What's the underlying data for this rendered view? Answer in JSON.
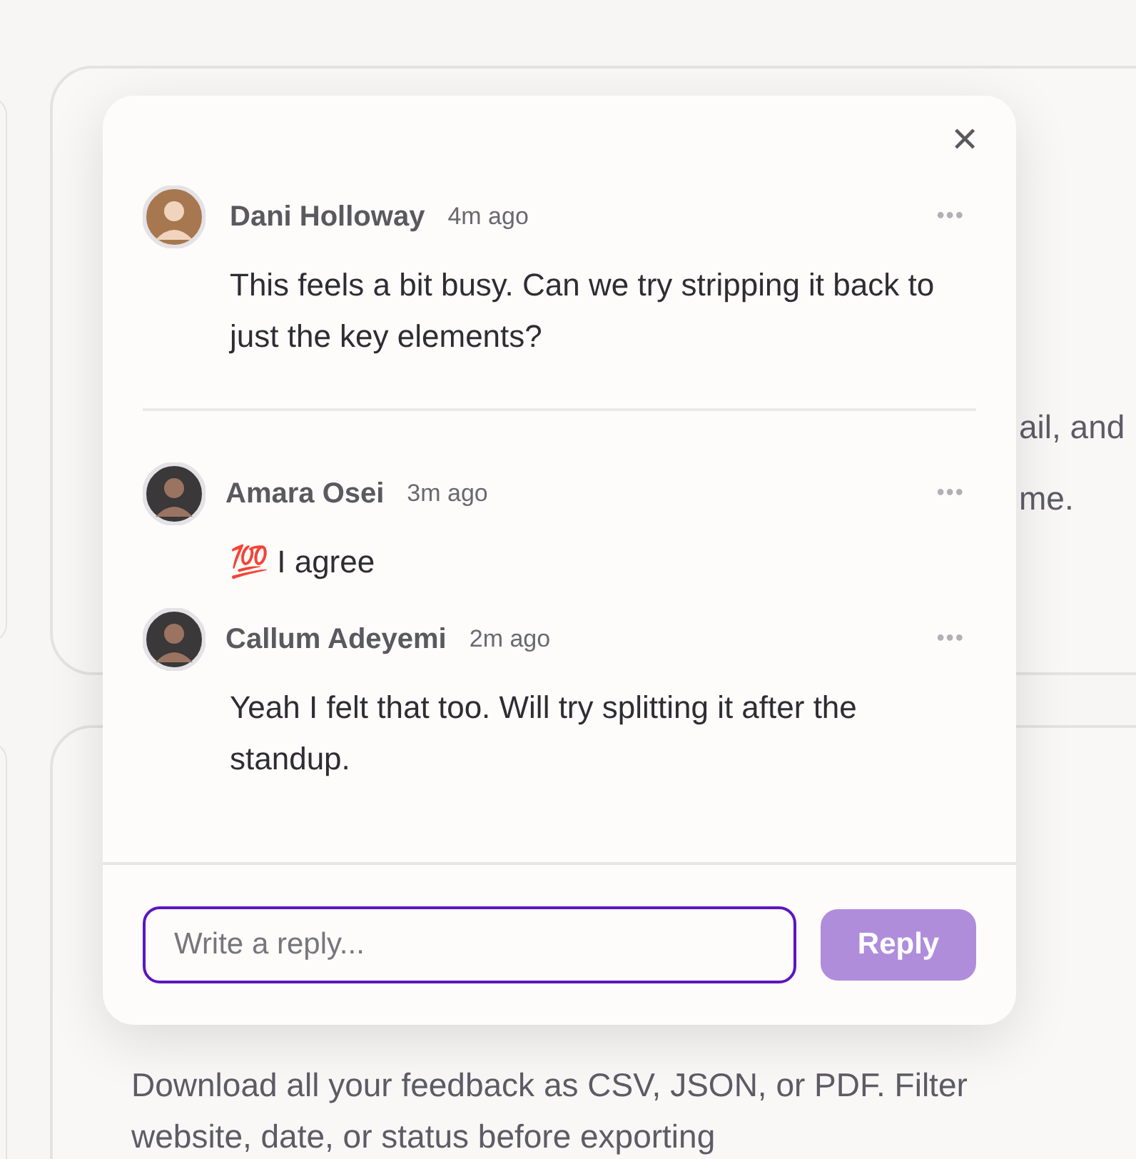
{
  "background": {
    "card_1_lines": [
      "ail, and",
      "me."
    ],
    "card_2_lines": [
      "Download all your feedback as CSV, JSON, or PDF. Filter",
      "website, date, or status before exporting"
    ]
  },
  "thread": {
    "close": "✕",
    "comment": {
      "author": "Dani Holloway",
      "time": "4m ago",
      "text": "This feels a bit busy. Can we try stripping it back to just the key elements?",
      "menu": "•••"
    },
    "replies": [
      {
        "author": "Amara Osei",
        "time": "3m ago",
        "text": "💯 I agree",
        "menu": "•••"
      },
      {
        "author": "Callum Adeyemi",
        "time": "2m ago",
        "text": "Yeah I felt that too. Will try splitting it after the standup.",
        "menu": "•••"
      }
    ],
    "reply_field": {
      "placeholder": "Write a reply..."
    },
    "reply_button": "Reply"
  }
}
